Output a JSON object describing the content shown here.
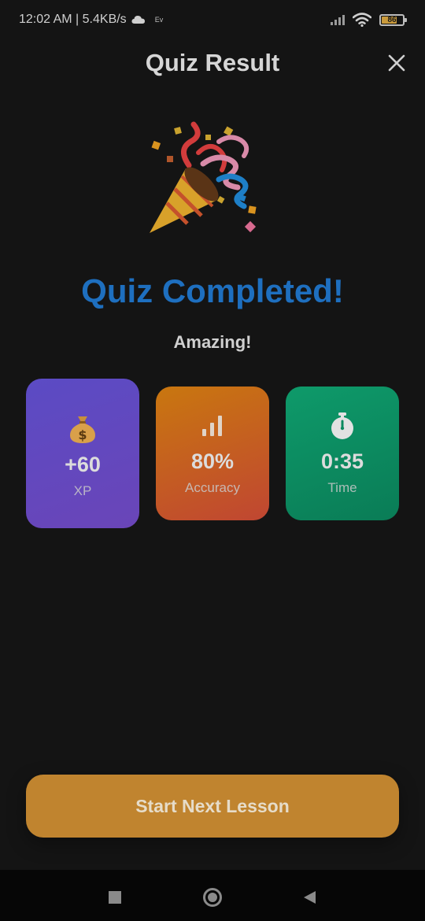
{
  "status_bar": {
    "time_speed": "12:02 AM | 5.4KB/s",
    "ev": "Ev",
    "battery": "86"
  },
  "header": {
    "title": "Quiz Result",
    "close_icon": "close-icon"
  },
  "celebration": {
    "icon": "party-popper-icon"
  },
  "result": {
    "title": "Quiz Completed!",
    "subtitle": "Amazing!"
  },
  "stats": {
    "xp": {
      "icon": "money-bag-icon",
      "value": "+60",
      "label": "XP",
      "color": "#5b4bc4"
    },
    "accuracy": {
      "icon": "signal-bars-icon",
      "value": "80%",
      "label": "Accuracy",
      "color": "#c9770f"
    },
    "time": {
      "icon": "stopwatch-icon",
      "value": "0:35",
      "label": "Time",
      "color": "#0e9a6a"
    }
  },
  "cta": {
    "label": "Start Next Lesson",
    "color": "#c0842f"
  },
  "colors": {
    "background": "#141414",
    "accent": "#1e6fbf"
  }
}
